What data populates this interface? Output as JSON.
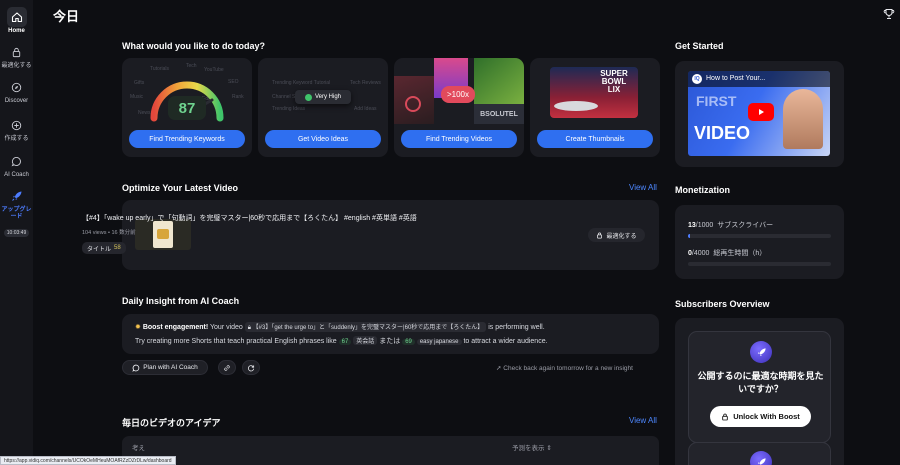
{
  "sidebar": {
    "items": [
      {
        "label": "Home"
      },
      {
        "label": "最適化する"
      },
      {
        "label": "Discover"
      },
      {
        "label": "作成する"
      },
      {
        "label": "AI Coach"
      },
      {
        "label": "アップグレード",
        "timer": "10:03:49"
      }
    ]
  },
  "header": {
    "title": "今日"
  },
  "todo": {
    "title": "What would you like to do today?",
    "cards": [
      {
        "button": "Find Trending Keywords",
        "score": "87",
        "gauge_words": [
          "Tutorials",
          "Tech",
          "YouTube",
          "Gifts",
          "SEO",
          "Music",
          "Rank",
          "Edit",
          "News"
        ]
      },
      {
        "button": "Get Video Ideas",
        "badge": "Very High",
        "ghost_words": [
          "Trending Keyword Tutorial",
          "Tech Reviews",
          "Channel Showcases",
          "Trending Ideas",
          "Add Ideas"
        ]
      },
      {
        "button": "Find Trending Videos",
        "badge": ">100x",
        "overlay": "BSOLUTEL"
      },
      {
        "button": "Create Thumbnails",
        "overlay": "SUPER BOWL LIX"
      }
    ]
  },
  "optimize": {
    "title": "Optimize Your Latest Video",
    "view_all": "View All",
    "video": {
      "title": "【#4】「wake up early」で「句動詞」を完璧マスター|60秒で応用まで【ろくたん】 #english #英単語 #英語",
      "meta": "104 views • 16 数分前",
      "chip_label": "タイトル",
      "chip_score": "58",
      "optimize_button": "最適化する"
    }
  },
  "insight": {
    "title": "Daily Insight from AI Coach",
    "boost_label": "Boost engagement!",
    "line1_a": "Your video",
    "video_ref": "【#3】「get the urge to」と「suddenly」を完璧マスター|60秒で応用まで【ろくたん】",
    "line1_b": "is performing well.",
    "line2_a": "Try creating more Shorts that teach practical English phrases like",
    "num1": "67",
    "phrase1": "英会話",
    "connector": "または",
    "num2": "69",
    "phrase2": "easy japanese",
    "line2_b": "to attract a wider audience.",
    "plan_button": "Plan with AI Coach",
    "check_back": "Check back again tomorrow for a new insight"
  },
  "ideas": {
    "title": "毎日のビデオのアイデア",
    "view_all": "View All",
    "col_idea": "考え",
    "col_show": "予測を表示"
  },
  "get_started": {
    "title": "Get Started",
    "video_title": "How to Post Your...",
    "thumb_text": [
      "FIRST",
      "VIDEO"
    ],
    "channel_badge": "IQ"
  },
  "monetization": {
    "title": "Monetization",
    "subscribers": {
      "value": "13",
      "max": "/1000",
      "label": "サブスクライバー",
      "progress": 0.013
    },
    "watch_hours": {
      "value": "0",
      "max": "/4000",
      "label": "総再生時間（h）",
      "progress": 0.0
    }
  },
  "subscribers_overview": {
    "title": "Subscribers Overview",
    "question": "公開するのに最適な時期を見たいですか？",
    "unlock_button": "Unlock With Boost"
  },
  "status_bar": {
    "url": "https://app.vidiq.com/channels/UCOkOeMHeuMOAfRZzDZrDLw/dashboard"
  },
  "colors": {
    "accent": "#2f6ff0",
    "link": "#4d87ff",
    "bg": "#0d0e12",
    "card": "#1b1c22"
  }
}
